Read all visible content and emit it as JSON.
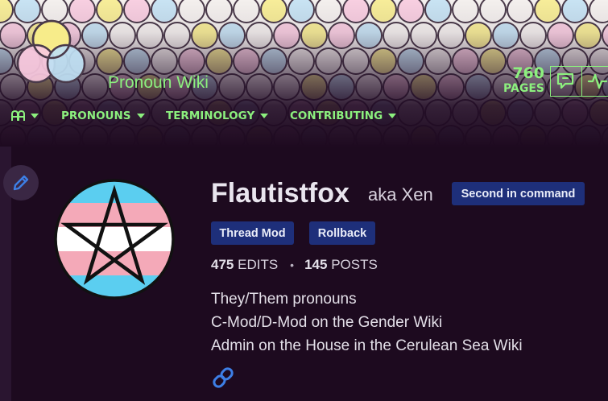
{
  "header": {
    "wiki_name": "Pronoun Wiki",
    "page_count": "760",
    "page_count_label": "PAGES",
    "accent_color": "#8cf07e",
    "icons": [
      "wiki-logo",
      "discussion-icon",
      "activity-icon"
    ]
  },
  "nav": {
    "items": [
      {
        "label": "",
        "icon": "explore-icon"
      },
      {
        "label": "PRONOUNS"
      },
      {
        "label": "TERMINOLOGY"
      },
      {
        "label": "CONTRIBUTING"
      }
    ]
  },
  "profile": {
    "username": "Flautistfox",
    "aka": "aka Xen",
    "badges": [
      "Second in command",
      "Thread Mod",
      "Rollback"
    ],
    "edits": "475",
    "edits_label": "EDITS",
    "separator": "•",
    "posts": "145",
    "posts_label": "POSTS",
    "bio": [
      "They/Them pronouns",
      "C-Mod/D-Mod on the Gender Wiki",
      "Admin on the House in the Cerulean Sea Wiki"
    ],
    "badge_color": "#1e2f7a",
    "background_color": "#1d0a1f"
  }
}
